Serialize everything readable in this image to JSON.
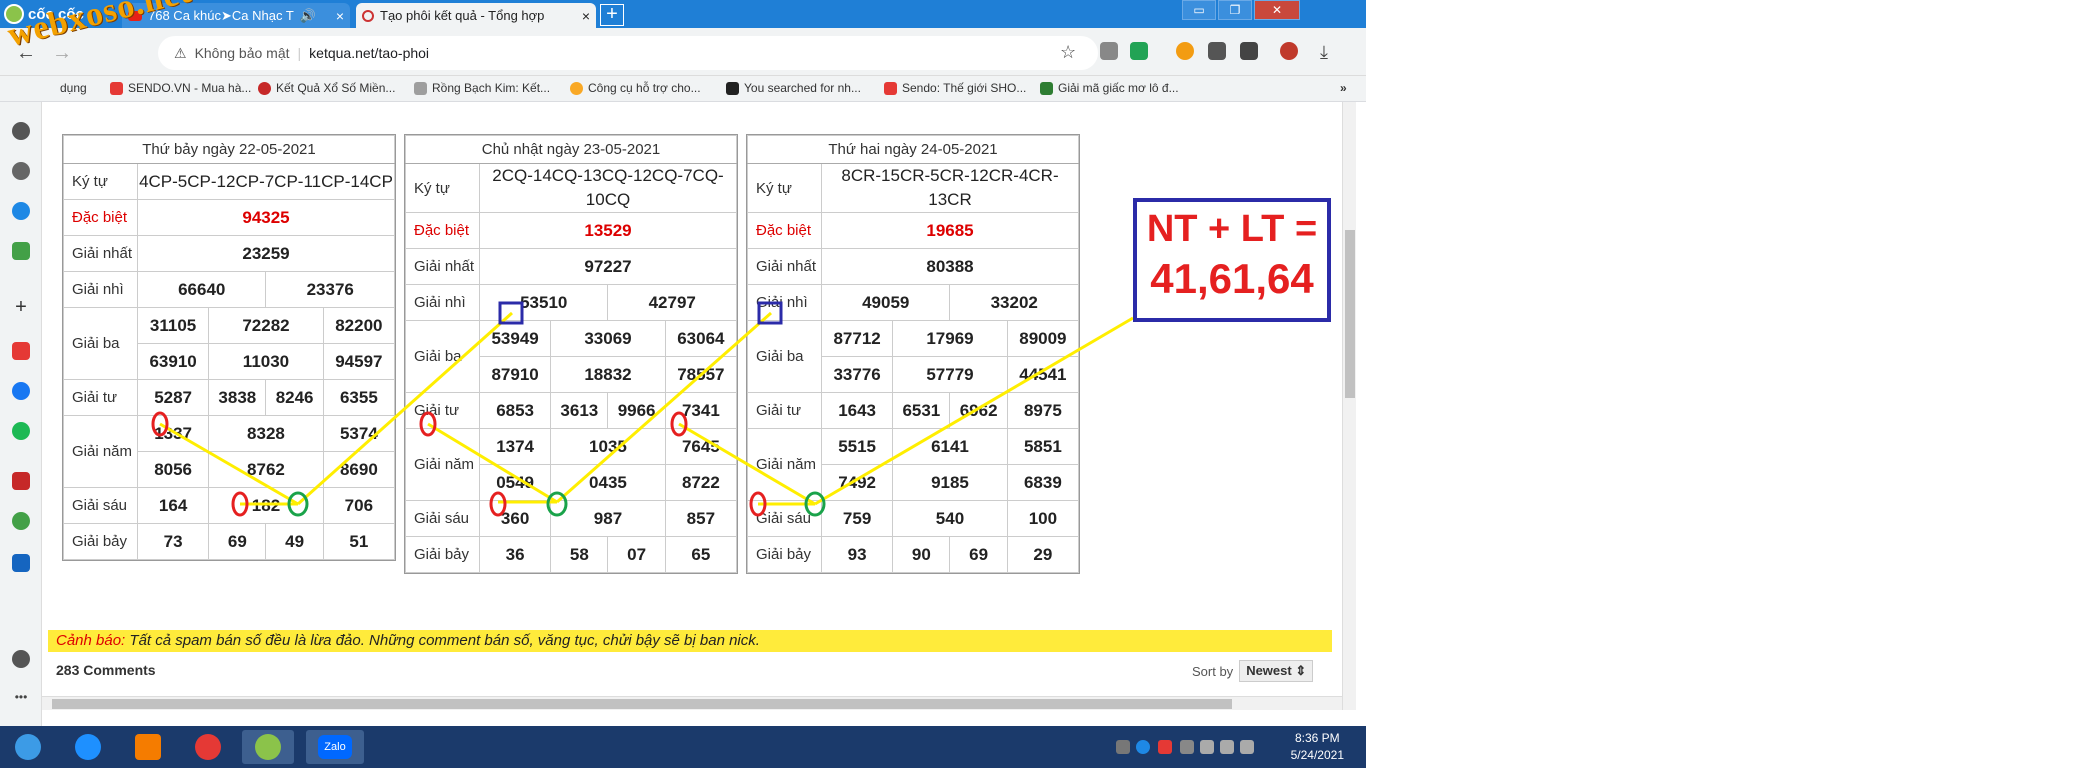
{
  "browser": {
    "brand": "cốc cốc",
    "tabs": [
      {
        "title": "768 Ca khúc➤Ca Nhạc T",
        "active": false
      },
      {
        "title": "Tạo phôi kết quả - Tổng hợp",
        "active": true
      }
    ],
    "omnibox": {
      "security": "Không bảo mật",
      "url": "ketqua.net/tao-phoi"
    },
    "bookmarks": [
      {
        "label": "dụng"
      },
      {
        "label": "SENDO.VN - Mua hà..."
      },
      {
        "label": "Kết Quả Xổ Số Miền..."
      },
      {
        "label": "Rồng Bạch Kim: Kết..."
      },
      {
        "label": "Công cụ hỗ trợ cho..."
      },
      {
        "label": "You searched for nh..."
      },
      {
        "label": "Sendo: Thế giới SHO..."
      },
      {
        "label": "Giải mã giấc mơ lô đ..."
      }
    ]
  },
  "watermark": "webxoso.net",
  "labels": {
    "kytu": "Ký tự",
    "db": "Đặc biệt",
    "g1": "Giải nhất",
    "g2": "Giải nhì",
    "g3": "Giải ba",
    "g4": "Giải tư",
    "g5": "Giải năm",
    "g6": "Giải sáu",
    "g7": "Giải bảy"
  },
  "boards": [
    {
      "title": "Thứ bảy ngày 22-05-2021",
      "kytu": "4CP-5CP-12CP-7CP-11CP-14CP",
      "db": "94325",
      "g1": "23259",
      "g2": [
        "66640",
        "23376"
      ],
      "g3": [
        "31105",
        "72282",
        "82200",
        "63910",
        "11030",
        "94597"
      ],
      "g4": [
        "5287",
        "3838",
        "8246",
        "6355"
      ],
      "g5": [
        "1337",
        "8328",
        "5374",
        "8056",
        "8762",
        "8690"
      ],
      "g6": [
        "164",
        "182",
        "706"
      ],
      "g7": [
        "73",
        "69",
        "49",
        "51"
      ]
    },
    {
      "title": "Chủ nhật ngày 23-05-2021",
      "kytu": "2CQ-14CQ-13CQ-12CQ-7CQ-10CQ",
      "db": "13529",
      "g1": "97227",
      "g2": [
        "53510",
        "42797"
      ],
      "g3": [
        "53949",
        "33069",
        "63064",
        "87910",
        "18832",
        "78557"
      ],
      "g4": [
        "6853",
        "3613",
        "9966",
        "7341"
      ],
      "g5": [
        "1374",
        "1035",
        "7645",
        "0549",
        "0435",
        "8722"
      ],
      "g6": [
        "360",
        "987",
        "857"
      ],
      "g7": [
        "36",
        "58",
        "07",
        "65"
      ]
    },
    {
      "title": "Thứ hai ngày 24-05-2021",
      "kytu": "8CR-15CR-5CR-12CR-4CR-13CR",
      "db": "19685",
      "g1": "80388",
      "g2": [
        "49059",
        "33202"
      ],
      "g3": [
        "87712",
        "17969",
        "89009",
        "33776",
        "57779",
        "44541"
      ],
      "g4": [
        "1643",
        "6531",
        "6962",
        "8975"
      ],
      "g5": [
        "5515",
        "6141",
        "5851",
        "7492",
        "9185",
        "6839"
      ],
      "g6": [
        "759",
        "540",
        "100"
      ],
      "g7": [
        "93",
        "90",
        "69",
        "29"
      ]
    }
  ],
  "callout": {
    "line1": "NT + LT =",
    "line2": "41,61,64"
  },
  "warning": {
    "prefix": "Cảnh báo:",
    "text": " Tất cả spam bán số đều là lừa đảo. Những comment bán số, văng tục, chửi bậy sẽ bị ban nick."
  },
  "comments": {
    "count": "283 Comments",
    "sort_label": "Sort by",
    "sort_value": "Newest"
  },
  "taskbar": {
    "time": "8:36 PM",
    "date": "5/24/2021",
    "zalo": "Zalo"
  },
  "colors": {
    "tabbar": "#1f7fd6",
    "highlight_red": "#e52020",
    "box_blue": "#2b2ba8",
    "yellow_line": "#ffee00",
    "green_circle": "#1aa34a"
  }
}
